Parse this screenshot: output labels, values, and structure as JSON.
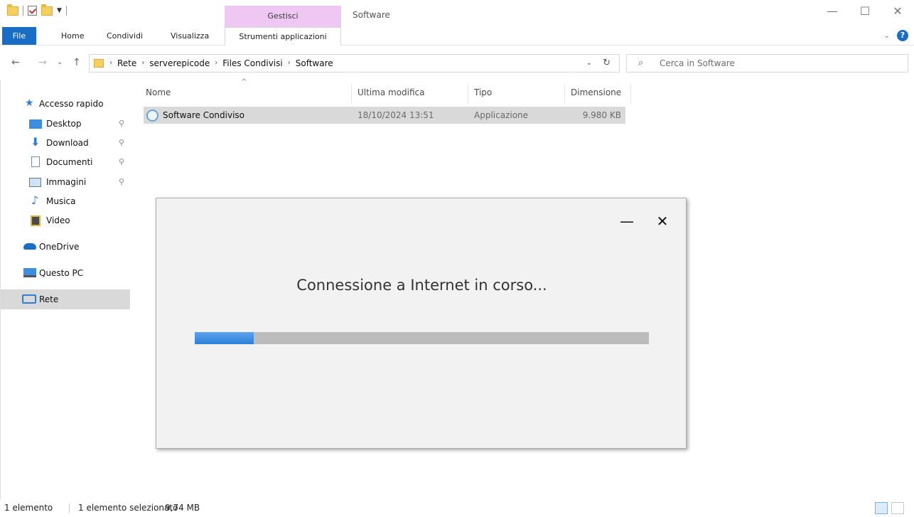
{
  "window": {
    "title": "Software",
    "context_tab": "Gestisci"
  },
  "ribbon": {
    "tabs": [
      "File",
      "Home",
      "Condividi",
      "Visualizza",
      "Strumenti applicazioni"
    ]
  },
  "address": {
    "crumbs": [
      "Rete",
      "serverepicode",
      "Files Condivisi",
      "Software"
    ],
    "search_placeholder": "Cerca in Software"
  },
  "sidebar": {
    "items": [
      {
        "label": "Accesso rapido",
        "icon": "star-icon"
      },
      {
        "label": "Desktop",
        "icon": "desktop-icon",
        "pinned": true
      },
      {
        "label": "Download",
        "icon": "download-icon",
        "pinned": true
      },
      {
        "label": "Documenti",
        "icon": "documents-icon",
        "pinned": true
      },
      {
        "label": "Immagini",
        "icon": "pictures-icon",
        "pinned": true
      },
      {
        "label": "Musica",
        "icon": "music-icon"
      },
      {
        "label": "Video",
        "icon": "video-icon"
      },
      {
        "label": "OneDrive",
        "icon": "cloud-icon"
      },
      {
        "label": "Questo PC",
        "icon": "computer-icon"
      },
      {
        "label": "Rete",
        "icon": "network-icon",
        "selected": true
      }
    ]
  },
  "files": {
    "columns": [
      "Nome",
      "Ultima modifica",
      "Tipo",
      "Dimensione"
    ],
    "rows": [
      {
        "name": "Software Condiviso",
        "modified": "18/10/2024 13:51",
        "type": "Applicazione",
        "size": "9.980 KB"
      }
    ]
  },
  "dialog": {
    "message": "Connessione a Internet in corso...",
    "progress_fraction": 0.13,
    "progress_color": "#2d7fd8"
  },
  "status": {
    "count": "1 elemento",
    "selected": "1 elemento selezionato",
    "size": "9,74 MB"
  },
  "colors": {
    "accent": "#1a6dc4",
    "context_tab": "#eec8f2"
  }
}
